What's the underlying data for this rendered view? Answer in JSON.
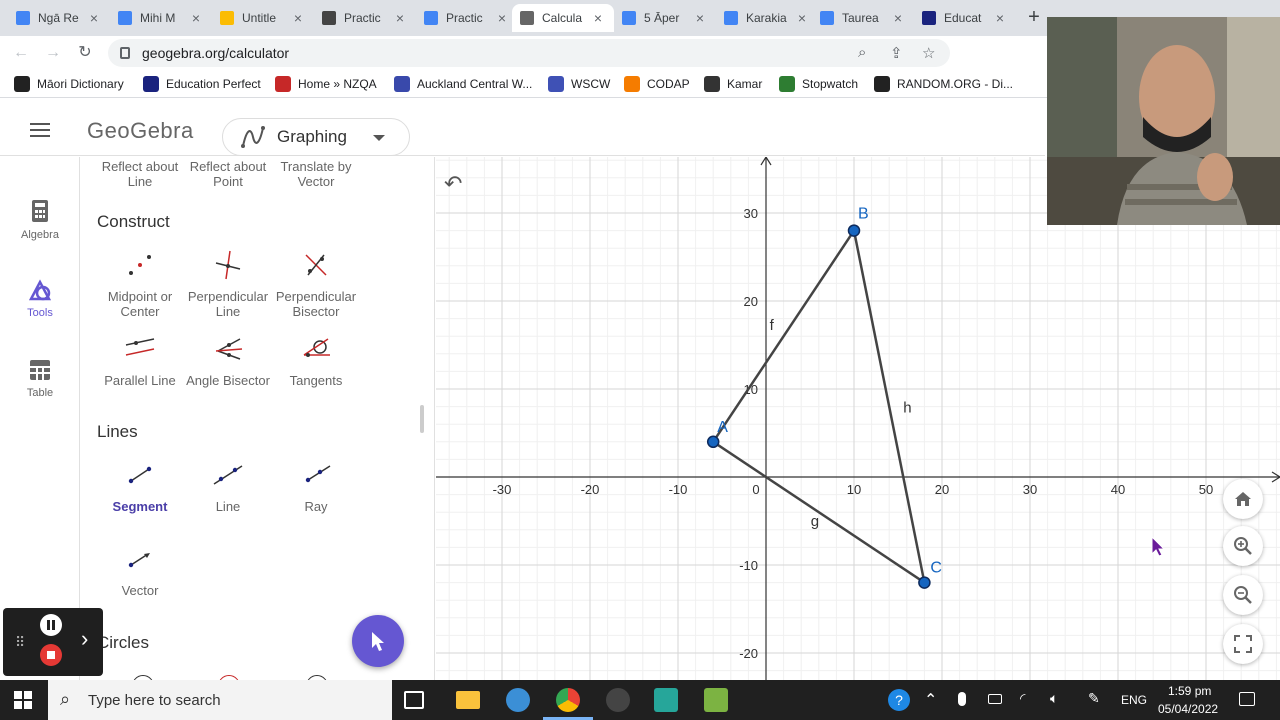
{
  "browser": {
    "tabs": [
      {
        "title": "Ngā Re",
        "color": "#4285f4",
        "glyph": "drive-icon"
      },
      {
        "title": "Mihi M",
        "color": "#4285f4",
        "glyph": "docs-icon"
      },
      {
        "title": "Untitle",
        "color": "#fbbc04",
        "glyph": "slides-icon"
      },
      {
        "title": "Practic",
        "color": "#444444",
        "glyph": "classroom-icon"
      },
      {
        "title": "Practic",
        "color": "#4285f4",
        "glyph": "docs-icon"
      },
      {
        "title": "Calcula",
        "color": "#666666",
        "glyph": "geogebra-icon"
      },
      {
        "title": "5 Āper",
        "color": "#4285f4",
        "glyph": "docs-icon"
      },
      {
        "title": "Karakia",
        "color": "#4285f4",
        "glyph": "docs-icon"
      },
      {
        "title": "Taurea",
        "color": "#4285f4",
        "glyph": "docs-icon"
      },
      {
        "title": "Educat",
        "color": "#1a237e",
        "glyph": "ep-icon"
      }
    ],
    "active_tab_index": 5,
    "url": "geogebra.org/calculator",
    "bookmarks": [
      {
        "label": "Māori Dictionary",
        "color": "#222222"
      },
      {
        "label": "Education Perfect",
        "color": "#1a237e"
      },
      {
        "label": "Home » NZQA",
        "color": "#c62828"
      },
      {
        "label": "Auckland Central W...",
        "color": "#3949ab"
      },
      {
        "label": "WSCW",
        "color": "#3f51b5"
      },
      {
        "label": "CODAP",
        "color": "#f57c00"
      },
      {
        "label": "Kamar",
        "color": "#333333"
      },
      {
        "label": "Stopwatch",
        "color": "#2e7d32"
      },
      {
        "label": "RANDOM.ORG - Di...",
        "color": "#222222"
      }
    ]
  },
  "app": {
    "logo": "GeoGebra",
    "mode": "Graphing"
  },
  "rail": [
    {
      "label": "Algebra",
      "active": false
    },
    {
      "label": "Tools",
      "active": true
    },
    {
      "label": "Table",
      "active": false
    }
  ],
  "tools_panel": {
    "transform_partial": [
      "Reflect about Line",
      "Reflect about Point",
      "Translate by Vector"
    ],
    "construct_title": "Construct",
    "construct": [
      "Midpoint or Center",
      "Perpendicular Line",
      "Perpendicular Bisector",
      "Parallel Line",
      "Angle Bisector",
      "Tangents"
    ],
    "lines_title": "Lines",
    "lines": [
      "Segment",
      "Line",
      "Ray",
      "Vector"
    ],
    "selected_tool": "Segment",
    "circles_title": "Circles"
  },
  "graph": {
    "x_ticks": [
      -30,
      -20,
      -10,
      0,
      10,
      20,
      30,
      40,
      50
    ],
    "y_ticks": [
      30,
      20,
      10,
      -10,
      -20
    ],
    "points": [
      {
        "name": "A",
        "x": -6,
        "y": 4
      },
      {
        "name": "B",
        "x": 10,
        "y": 28
      },
      {
        "name": "C",
        "x": 18,
        "y": -12
      }
    ],
    "segments": [
      {
        "name": "f",
        "from": "A",
        "to": "B"
      },
      {
        "name": "h",
        "from": "B",
        "to": "C"
      },
      {
        "name": "g",
        "from": "A",
        "to": "C"
      }
    ],
    "point_color": "#1565c0",
    "segment_color": "#444444"
  },
  "taskbar": {
    "search_placeholder": "Type here to search",
    "language": "ENG",
    "time": "1:59 pm",
    "date": "05/04/2022"
  }
}
